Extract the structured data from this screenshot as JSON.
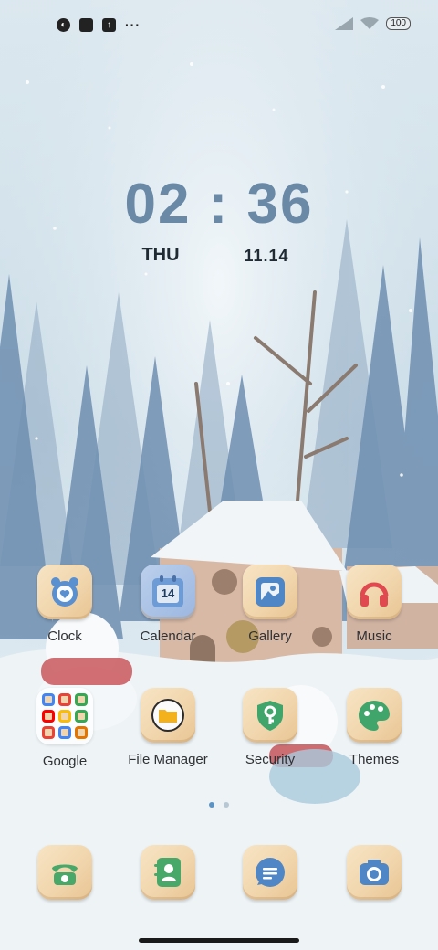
{
  "status_bar": {
    "battery": "100",
    "more": "···"
  },
  "clock": {
    "time": "02 : 36",
    "day": "THU",
    "date": "11.14"
  },
  "apps": [
    {
      "label": "Clock",
      "icon": "alarm-clock-icon",
      "color": "#5a8fd0"
    },
    {
      "label": "Calendar",
      "icon": "calendar-icon",
      "color": "#6d9bd6",
      "badge": "14"
    },
    {
      "label": "Gallery",
      "icon": "gallery-icon",
      "color": "#4f86c5"
    },
    {
      "label": "Music",
      "icon": "headphones-icon",
      "color": "#e0494f"
    },
    {
      "label": "Google",
      "icon": "folder-icon"
    },
    {
      "label": "File Manager",
      "icon": "folder-file-icon",
      "color": "#f3b21c"
    },
    {
      "label": "Security",
      "icon": "shield-key-icon",
      "color": "#3fa56b"
    },
    {
      "label": "Themes",
      "icon": "palette-icon",
      "color": "#3fa56b"
    }
  ],
  "dock": [
    {
      "icon": "phone-icon",
      "color": "#48a86a"
    },
    {
      "icon": "contacts-icon",
      "color": "#48a86a"
    },
    {
      "icon": "messages-icon",
      "color": "#4f86c5"
    },
    {
      "icon": "camera-icon",
      "color": "#4f86c5"
    }
  ],
  "page_indicator": {
    "count": 2,
    "active": 0
  }
}
